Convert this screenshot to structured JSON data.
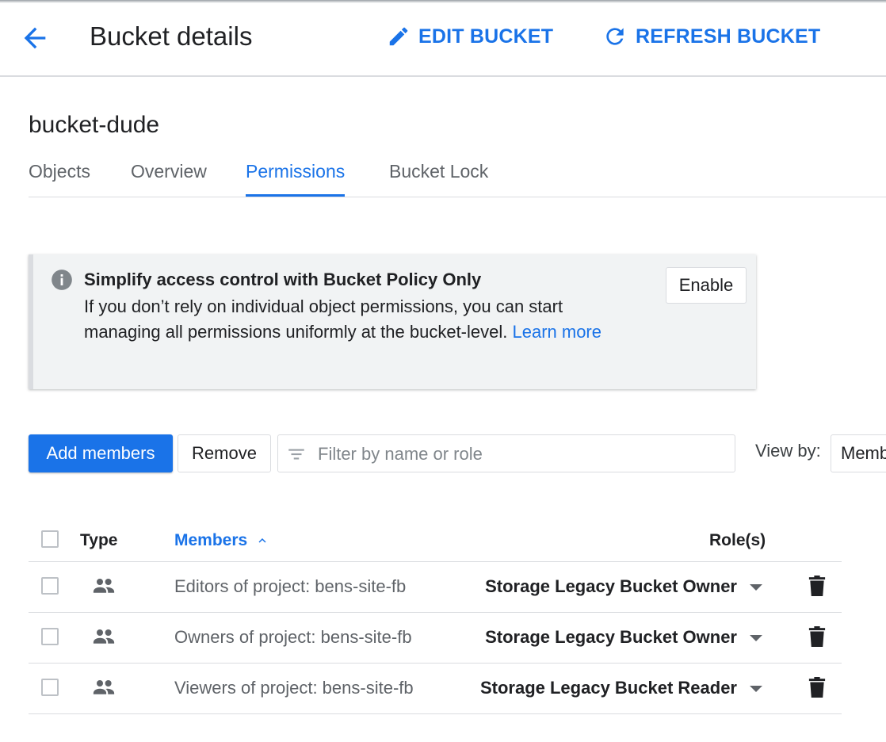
{
  "header": {
    "title": "Bucket details",
    "edit_label": "EDIT BUCKET",
    "refresh_label": "REFRESH BUCKET"
  },
  "bucket_name": "bucket-dude",
  "tabs": [
    {
      "label": "Objects",
      "active": false
    },
    {
      "label": "Overview",
      "active": false
    },
    {
      "label": "Permissions",
      "active": true
    },
    {
      "label": "Bucket Lock",
      "active": false
    }
  ],
  "banner": {
    "title": "Simplify access control with Bucket Policy Only",
    "body": "If you don’t rely on individual object permissions, you can start managing all permissions uniformly at the bucket-level.",
    "link": "Learn more",
    "enable_label": "Enable"
  },
  "toolbar": {
    "add_members_label": "Add members",
    "remove_label": "Remove",
    "filter_placeholder": "Filter by name or role",
    "view_by_label": "View by:",
    "view_by_value": "Members"
  },
  "table": {
    "headers": {
      "type": "Type",
      "members": "Members",
      "roles": "Role(s)"
    },
    "rows": [
      {
        "member": "Editors of project: bens-site-fb",
        "role": "Storage Legacy Bucket Owner"
      },
      {
        "member": "Owners of project: bens-site-fb",
        "role": "Storage Legacy Bucket Owner"
      },
      {
        "member": "Viewers of project: bens-site-fb",
        "role": "Storage Legacy Bucket Reader"
      }
    ]
  },
  "colors": {
    "accent": "#1a73e8",
    "text": "#202124",
    "muted": "#5f6368",
    "divider": "#dadce0"
  }
}
